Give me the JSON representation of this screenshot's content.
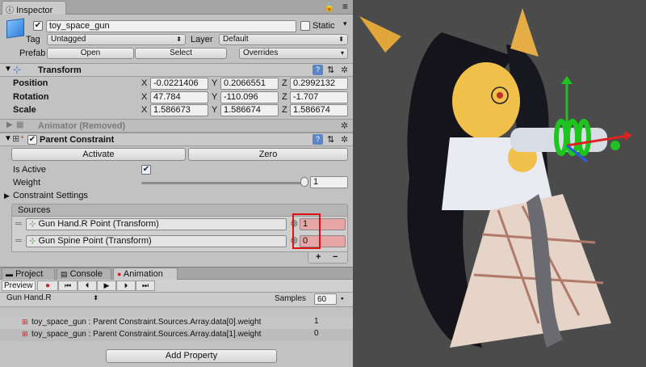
{
  "inspector": {
    "tab_label": "Inspector",
    "object_name": "toy_space_gun",
    "static_label": "Static",
    "tag_label": "Tag",
    "tag_value": "Untagged",
    "layer_label": "Layer",
    "layer_value": "Default",
    "prefab_label": "Prefab",
    "open_label": "Open",
    "select_label": "Select",
    "overrides_label": "Overrides"
  },
  "transform": {
    "title": "Transform",
    "position_label": "Position",
    "rotation_label": "Rotation",
    "scale_label": "Scale",
    "x": "X",
    "y": "Y",
    "z": "Z",
    "position": [
      "-0.0221406",
      "0.2066551",
      "0.2992132"
    ],
    "rotation": [
      "47.784",
      "-110.096",
      "-1.707"
    ],
    "scale": [
      "1.586673",
      "1.586674",
      "1.586674"
    ]
  },
  "animator": {
    "title": "Animator (Removed)"
  },
  "parent_constraint": {
    "title": "Parent Constraint",
    "activate_label": "Activate",
    "zero_label": "Zero",
    "is_active_label": "Is Active",
    "weight_label": "Weight",
    "weight_value": "1",
    "weight_fraction": 1.0,
    "settings_label": "Constraint Settings",
    "sources_label": "Sources",
    "sources": [
      {
        "name": "Gun Hand.R Point (Transform)",
        "weight": "1"
      },
      {
        "name": "Gun Spine Point (Transform)",
        "weight": "0"
      }
    ],
    "plus_label": "+",
    "minus_label": "−"
  },
  "bottom_tabs": {
    "project": "Project",
    "console": "Console",
    "animation": "Animation"
  },
  "animation": {
    "preview_label": "Preview",
    "clip_value": "Gun Hand.R",
    "samples_label": "Samples",
    "samples_value": "60",
    "properties": [
      {
        "name": "toy_space_gun : Parent Constraint.Sources.Array.data[0].weight",
        "value": "1"
      },
      {
        "name": "toy_space_gun : Parent Constraint.Sources.Array.data[1].weight",
        "value": "0"
      }
    ],
    "add_property_label": "Add Property"
  },
  "colors": {
    "highlight": "#e01010",
    "record": "#d21f1f",
    "panel": "#c2c2c2"
  }
}
